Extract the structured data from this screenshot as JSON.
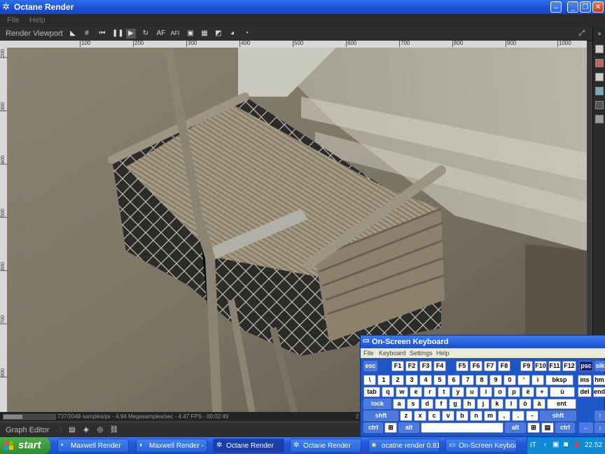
{
  "window": {
    "title": "Octane Render",
    "icon": "octane-icon"
  },
  "menubar": {
    "items": [
      "File",
      "Help"
    ]
  },
  "toolbar": {
    "viewport_label": "Render Viewport",
    "af_label": "AF",
    "afi_label": "AFI"
  },
  "ruler": {
    "h_labels": [
      "100",
      "200",
      "300",
      "400",
      "500",
      "600",
      "700",
      "800",
      "900",
      "1000"
    ],
    "v_labels": [
      "200",
      "300",
      "400",
      "500",
      "600",
      "700",
      "800"
    ]
  },
  "status": {
    "text": "737/2048 samples/px - 4.94 Megasamples/sec - 4.47 FPS - 00:02:49",
    "progress": 0.36,
    "right_label": "2"
  },
  "graph_editor": {
    "label": "Graph Editor"
  },
  "osk": {
    "title": "On-Screen Keyboard",
    "menu": [
      "File",
      "Keyboard",
      "Settings",
      "Help"
    ],
    "rows": [
      [
        "esc",
        "F1",
        "F2",
        "F3",
        "F4",
        "F5",
        "F6",
        "F7",
        "F8",
        "F9",
        "F10",
        "F11",
        "F12",
        "psc",
        "slk"
      ],
      [
        "\\",
        "1",
        "2",
        "3",
        "4",
        "5",
        "6",
        "7",
        "8",
        "9",
        "0",
        "'",
        "ì",
        "bksp",
        "ins",
        "hm"
      ],
      [
        "tab",
        "q",
        "w",
        "e",
        "r",
        "t",
        "y",
        "u",
        "i",
        "o",
        "p",
        "è",
        "+",
        "ù",
        "del",
        "end"
      ],
      [
        "lock",
        "a",
        "s",
        "d",
        "f",
        "g",
        "h",
        "j",
        "k",
        "l",
        "ò",
        "à",
        "ent"
      ],
      [
        "shft",
        "z",
        "x",
        "c",
        "v",
        "b",
        "n",
        "m",
        ",",
        ".",
        "-",
        "shft",
        "↑"
      ],
      [
        "ctrl",
        "⊞",
        "alt",
        "",
        "alt",
        "⊞",
        "▤",
        "ctrl",
        "←",
        "↓"
      ]
    ]
  },
  "taskbar": {
    "start": "start",
    "tasks": [
      {
        "label": "Maxwell Render",
        "icon": "console-icon"
      },
      {
        "label": "Maxwell Render  - ...",
        "icon": "maxwell-icon"
      },
      {
        "label": "Octane Render",
        "icon": "octane-icon"
      },
      {
        "label": "Octane Render",
        "icon": "octane-icon"
      },
      {
        "label": "ocatne render 0.81a",
        "icon": "folder-icon"
      },
      {
        "label": "On-Screen Keyboard",
        "icon": "keyboard-icon"
      }
    ],
    "language": "IT",
    "clock": "22.52"
  }
}
